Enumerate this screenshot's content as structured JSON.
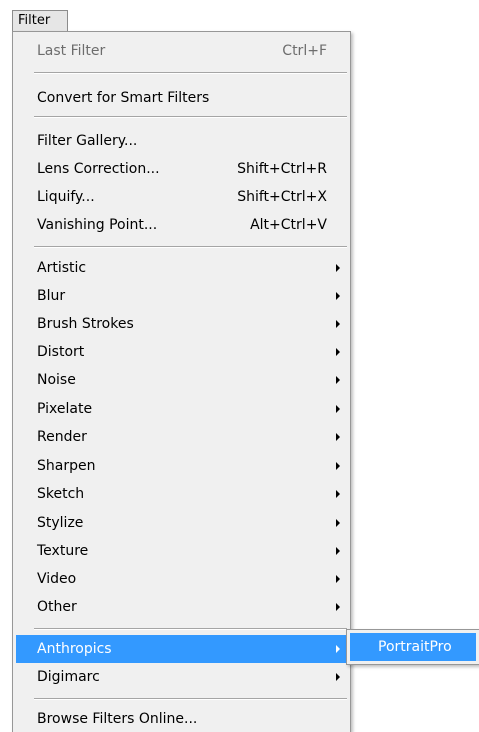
{
  "menubar": {
    "title": "Filter"
  },
  "menu": {
    "last_filter": {
      "label": "Last Filter",
      "shortcut": "Ctrl+F"
    },
    "convert_smart": {
      "label": "Convert for Smart Filters"
    },
    "filter_gallery": {
      "label": "Filter Gallery..."
    },
    "lens_correction": {
      "label": "Lens Correction...",
      "shortcut": "Shift+Ctrl+R"
    },
    "liquify": {
      "label": "Liquify...",
      "shortcut": "Shift+Ctrl+X"
    },
    "vanishing_point": {
      "label": "Vanishing Point...",
      "shortcut": "Alt+Ctrl+V"
    },
    "submenus": [
      "Artistic",
      "Blur",
      "Brush Strokes",
      "Distort",
      "Noise",
      "Pixelate",
      "Render",
      "Sharpen",
      "Sketch",
      "Stylize",
      "Texture",
      "Video",
      "Other"
    ],
    "anthropics": {
      "label": "Anthropics"
    },
    "digimarc": {
      "label": "Digimarc"
    },
    "browse_online": {
      "label": "Browse Filters Online..."
    }
  },
  "anthropics_submenu": {
    "portraitpro": {
      "label": "PortraitPro"
    }
  },
  "colors": {
    "highlight": "#3399ff",
    "menu_bg": "#f0f0f0",
    "disabled_text": "#6d6d6d"
  }
}
